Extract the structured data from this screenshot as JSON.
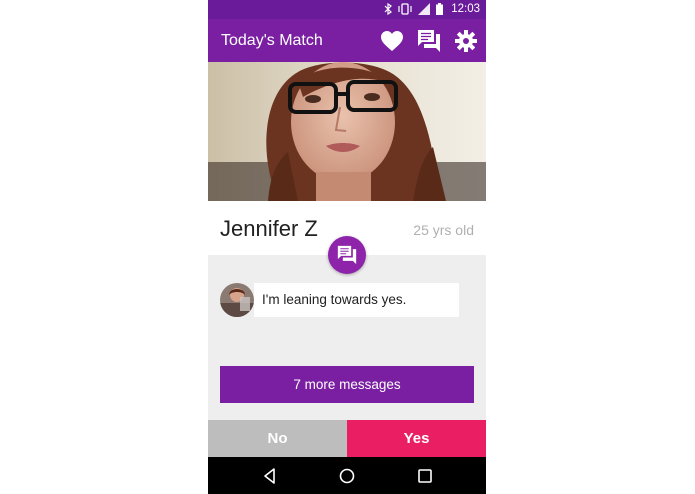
{
  "status_bar": {
    "time": "12:03",
    "icons": [
      "bluetooth-icon",
      "vibrate-icon",
      "signal-icon",
      "battery-icon"
    ]
  },
  "app_bar": {
    "title": "Today's Match",
    "actions": [
      "heart-icon",
      "chat-icon",
      "settings-icon"
    ],
    "color": "#7b1fa2"
  },
  "profile": {
    "name": "Jennifer Z",
    "age": "25 yrs old"
  },
  "messages": [
    {
      "text": "I'm leaning towards yes."
    }
  ],
  "more_messages": {
    "label": "7 more messages"
  },
  "actions": {
    "no_label": "No",
    "yes_label": "Yes",
    "no_color": "#bdbdbd",
    "yes_color": "#e91e63"
  },
  "nav_bar": {
    "buttons": [
      "back-icon",
      "home-icon",
      "recents-icon"
    ]
  }
}
